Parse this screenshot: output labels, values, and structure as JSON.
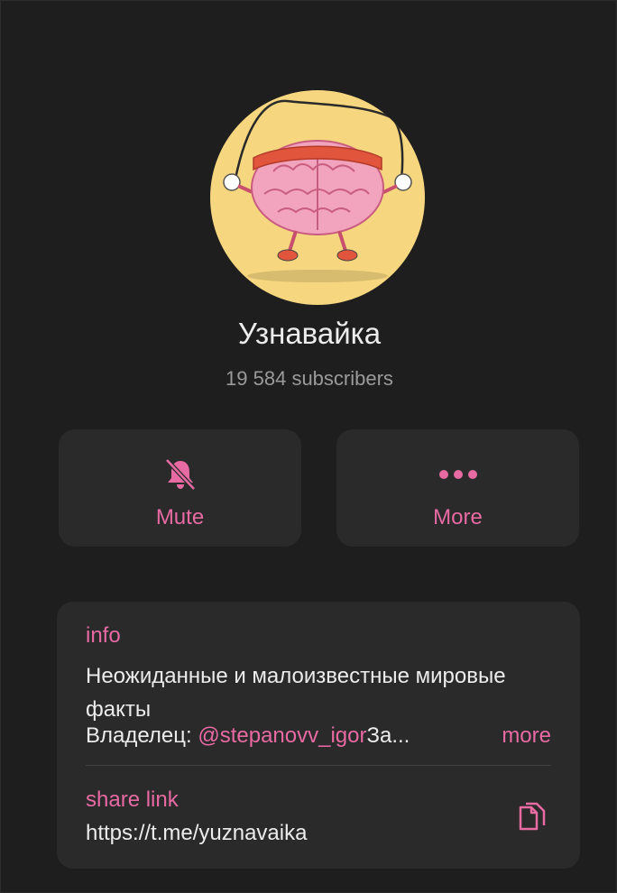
{
  "channel": {
    "name": "Узнавайка",
    "subscribers": "19 584 subscribers"
  },
  "actions": {
    "mute_label": "Mute",
    "more_label": "More"
  },
  "info": {
    "label": "info",
    "description": "Неожиданные и малоизвестные мировые факты",
    "owner_prefix": "Владелец: ",
    "owner_handle": "@stepanovv_igor",
    "owner_suffix": "За...",
    "more_label": "more"
  },
  "share": {
    "label": "share link",
    "url": "https://t.me/yuznavaika"
  },
  "icons": {
    "mute": "bell-slash-icon",
    "more": "ellipsis-icon",
    "copy": "copy-icon",
    "avatar": "brain-jump-rope"
  },
  "colors": {
    "background": "#1e1e1e",
    "card": "#2a2a2a",
    "accent": "#e86aa2",
    "text": "#ececec",
    "muted": "#9a9a9a",
    "avatar_bg": "#f6d77f"
  }
}
